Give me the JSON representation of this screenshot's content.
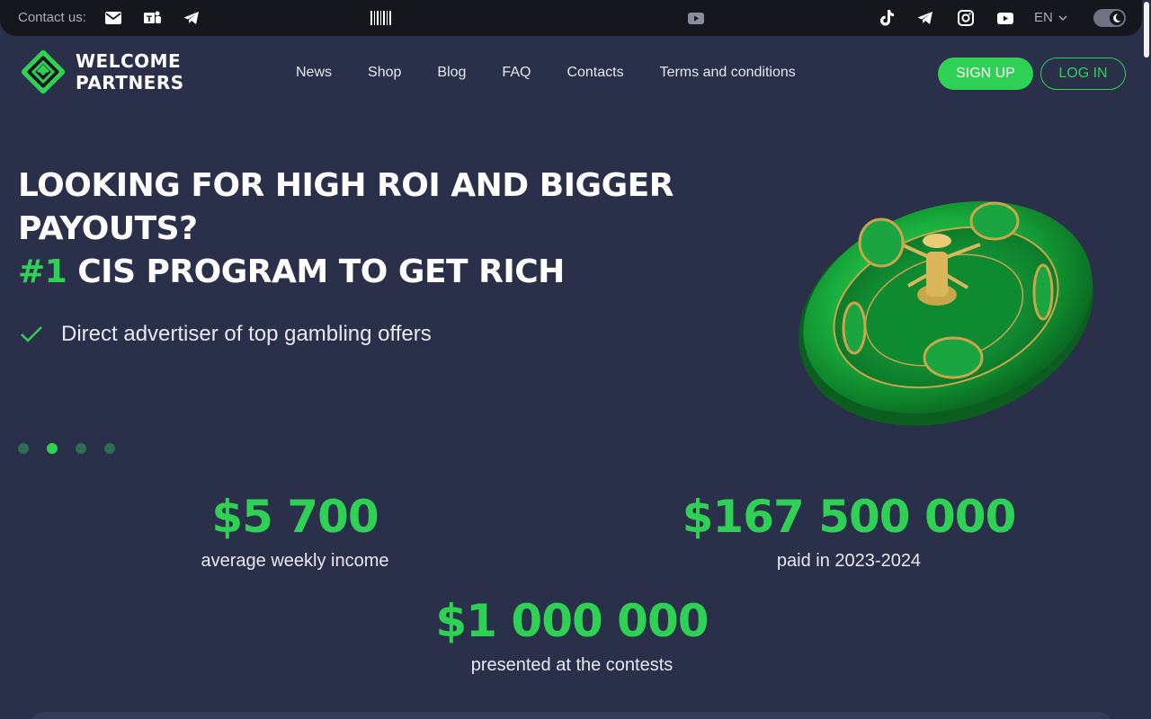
{
  "topbar": {
    "contact_label": "Contact us:",
    "icons": [
      "mail-icon",
      "teams-icon",
      "telegram-icon",
      "barcode-icon",
      "youtube-icon",
      "tiktok-icon",
      "telegram-icon",
      "instagram-icon",
      "youtube-icon"
    ],
    "language": "EN"
  },
  "header": {
    "logo_line1": "WELCOME",
    "logo_line2": "PARTNERS",
    "nav": [
      "News",
      "Shop",
      "Blog",
      "FAQ",
      "Contacts",
      "Terms and conditions"
    ],
    "signup_label": "SIGN UP",
    "login_label": "LOG IN"
  },
  "hero": {
    "title_line1": "LOOKING FOR HIGH ROI AND BIGGER",
    "title_line2": "PAYOUTS?",
    "title_accent": "#1",
    "title_line3": " CIS PROGRAM TO GET RICH",
    "bullet": "Direct advertiser of top gambling offers",
    "slides_total": 4,
    "active_slide": 2
  },
  "stats": [
    {
      "value": "$5 700",
      "label": "average weekly income"
    },
    {
      "value": "$167 500 000",
      "label": "paid in 2023-2024"
    },
    {
      "value": "$1 000 000",
      "label": "presented at the contests"
    }
  ],
  "colors": {
    "background": "#2a2f4a",
    "accent": "#2fd154",
    "topbar": "#15171c"
  }
}
